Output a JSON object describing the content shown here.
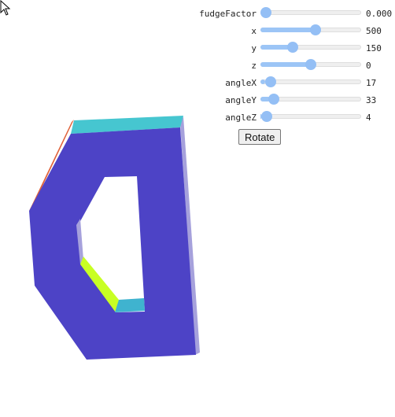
{
  "controls": [
    {
      "id": "fudgeFactor",
      "label": "fudgeFactor",
      "value": "0.000",
      "level": 0.0
    },
    {
      "id": "x",
      "label": "x",
      "value": "500",
      "level": 0.55
    },
    {
      "id": "y",
      "label": "y",
      "value": "150",
      "level": 0.3
    },
    {
      "id": "z",
      "label": "z",
      "value": "0",
      "level": 0.5
    },
    {
      "id": "angleX",
      "label": "angleX",
      "value": "17",
      "level": 0.05
    },
    {
      "id": "angleY",
      "label": "angleY",
      "value": "33",
      "level": 0.09
    },
    {
      "id": "angleZ",
      "label": "angleZ",
      "value": "4",
      "level": 0.01
    }
  ],
  "rotate_button": {
    "label": "Rotate"
  },
  "colors": {
    "front_face": "#4d43c6",
    "top_face": "#46c6d0",
    "left_edge": "#e0623a",
    "right_side": "#a6a1dc",
    "inner_lower_face": "#c8ff24",
    "inner_bottom_face": "#3fb3cf",
    "slider_fill": "#9cc5f6",
    "slider_thumb": "#94bff5"
  },
  "icons": {
    "cursor": "arrow-cursor-icon"
  }
}
